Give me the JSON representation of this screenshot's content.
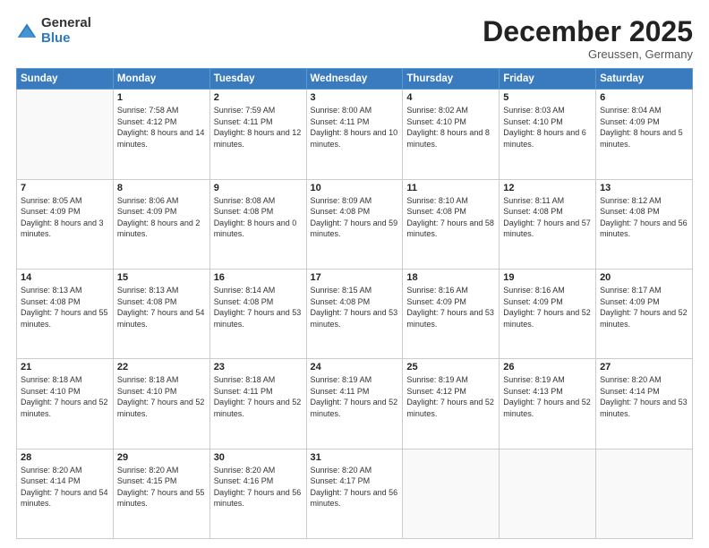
{
  "logo": {
    "general": "General",
    "blue": "Blue"
  },
  "header": {
    "month": "December 2025",
    "location": "Greussen, Germany"
  },
  "weekdays": [
    "Sunday",
    "Monday",
    "Tuesday",
    "Wednesday",
    "Thursday",
    "Friday",
    "Saturday"
  ],
  "weeks": [
    [
      {
        "day": "",
        "sunrise": "",
        "sunset": "",
        "daylight": ""
      },
      {
        "day": "1",
        "sunrise": "Sunrise: 7:58 AM",
        "sunset": "Sunset: 4:12 PM",
        "daylight": "Daylight: 8 hours and 14 minutes."
      },
      {
        "day": "2",
        "sunrise": "Sunrise: 7:59 AM",
        "sunset": "Sunset: 4:11 PM",
        "daylight": "Daylight: 8 hours and 12 minutes."
      },
      {
        "day": "3",
        "sunrise": "Sunrise: 8:00 AM",
        "sunset": "Sunset: 4:11 PM",
        "daylight": "Daylight: 8 hours and 10 minutes."
      },
      {
        "day": "4",
        "sunrise": "Sunrise: 8:02 AM",
        "sunset": "Sunset: 4:10 PM",
        "daylight": "Daylight: 8 hours and 8 minutes."
      },
      {
        "day": "5",
        "sunrise": "Sunrise: 8:03 AM",
        "sunset": "Sunset: 4:10 PM",
        "daylight": "Daylight: 8 hours and 6 minutes."
      },
      {
        "day": "6",
        "sunrise": "Sunrise: 8:04 AM",
        "sunset": "Sunset: 4:09 PM",
        "daylight": "Daylight: 8 hours and 5 minutes."
      }
    ],
    [
      {
        "day": "7",
        "sunrise": "Sunrise: 8:05 AM",
        "sunset": "Sunset: 4:09 PM",
        "daylight": "Daylight: 8 hours and 3 minutes."
      },
      {
        "day": "8",
        "sunrise": "Sunrise: 8:06 AM",
        "sunset": "Sunset: 4:09 PM",
        "daylight": "Daylight: 8 hours and 2 minutes."
      },
      {
        "day": "9",
        "sunrise": "Sunrise: 8:08 AM",
        "sunset": "Sunset: 4:08 PM",
        "daylight": "Daylight: 8 hours and 0 minutes."
      },
      {
        "day": "10",
        "sunrise": "Sunrise: 8:09 AM",
        "sunset": "Sunset: 4:08 PM",
        "daylight": "Daylight: 7 hours and 59 minutes."
      },
      {
        "day": "11",
        "sunrise": "Sunrise: 8:10 AM",
        "sunset": "Sunset: 4:08 PM",
        "daylight": "Daylight: 7 hours and 58 minutes."
      },
      {
        "day": "12",
        "sunrise": "Sunrise: 8:11 AM",
        "sunset": "Sunset: 4:08 PM",
        "daylight": "Daylight: 7 hours and 57 minutes."
      },
      {
        "day": "13",
        "sunrise": "Sunrise: 8:12 AM",
        "sunset": "Sunset: 4:08 PM",
        "daylight": "Daylight: 7 hours and 56 minutes."
      }
    ],
    [
      {
        "day": "14",
        "sunrise": "Sunrise: 8:13 AM",
        "sunset": "Sunset: 4:08 PM",
        "daylight": "Daylight: 7 hours and 55 minutes."
      },
      {
        "day": "15",
        "sunrise": "Sunrise: 8:13 AM",
        "sunset": "Sunset: 4:08 PM",
        "daylight": "Daylight: 7 hours and 54 minutes."
      },
      {
        "day": "16",
        "sunrise": "Sunrise: 8:14 AM",
        "sunset": "Sunset: 4:08 PM",
        "daylight": "Daylight: 7 hours and 53 minutes."
      },
      {
        "day": "17",
        "sunrise": "Sunrise: 8:15 AM",
        "sunset": "Sunset: 4:08 PM",
        "daylight": "Daylight: 7 hours and 53 minutes."
      },
      {
        "day": "18",
        "sunrise": "Sunrise: 8:16 AM",
        "sunset": "Sunset: 4:09 PM",
        "daylight": "Daylight: 7 hours and 53 minutes."
      },
      {
        "day": "19",
        "sunrise": "Sunrise: 8:16 AM",
        "sunset": "Sunset: 4:09 PM",
        "daylight": "Daylight: 7 hours and 52 minutes."
      },
      {
        "day": "20",
        "sunrise": "Sunrise: 8:17 AM",
        "sunset": "Sunset: 4:09 PM",
        "daylight": "Daylight: 7 hours and 52 minutes."
      }
    ],
    [
      {
        "day": "21",
        "sunrise": "Sunrise: 8:18 AM",
        "sunset": "Sunset: 4:10 PM",
        "daylight": "Daylight: 7 hours and 52 minutes."
      },
      {
        "day": "22",
        "sunrise": "Sunrise: 8:18 AM",
        "sunset": "Sunset: 4:10 PM",
        "daylight": "Daylight: 7 hours and 52 minutes."
      },
      {
        "day": "23",
        "sunrise": "Sunrise: 8:18 AM",
        "sunset": "Sunset: 4:11 PM",
        "daylight": "Daylight: 7 hours and 52 minutes."
      },
      {
        "day": "24",
        "sunrise": "Sunrise: 8:19 AM",
        "sunset": "Sunset: 4:11 PM",
        "daylight": "Daylight: 7 hours and 52 minutes."
      },
      {
        "day": "25",
        "sunrise": "Sunrise: 8:19 AM",
        "sunset": "Sunset: 4:12 PM",
        "daylight": "Daylight: 7 hours and 52 minutes."
      },
      {
        "day": "26",
        "sunrise": "Sunrise: 8:19 AM",
        "sunset": "Sunset: 4:13 PM",
        "daylight": "Daylight: 7 hours and 52 minutes."
      },
      {
        "day": "27",
        "sunrise": "Sunrise: 8:20 AM",
        "sunset": "Sunset: 4:14 PM",
        "daylight": "Daylight: 7 hours and 53 minutes."
      }
    ],
    [
      {
        "day": "28",
        "sunrise": "Sunrise: 8:20 AM",
        "sunset": "Sunset: 4:14 PM",
        "daylight": "Daylight: 7 hours and 54 minutes."
      },
      {
        "day": "29",
        "sunrise": "Sunrise: 8:20 AM",
        "sunset": "Sunset: 4:15 PM",
        "daylight": "Daylight: 7 hours and 55 minutes."
      },
      {
        "day": "30",
        "sunrise": "Sunrise: 8:20 AM",
        "sunset": "Sunset: 4:16 PM",
        "daylight": "Daylight: 7 hours and 56 minutes."
      },
      {
        "day": "31",
        "sunrise": "Sunrise: 8:20 AM",
        "sunset": "Sunset: 4:17 PM",
        "daylight": "Daylight: 7 hours and 56 minutes."
      },
      {
        "day": "",
        "sunrise": "",
        "sunset": "",
        "daylight": ""
      },
      {
        "day": "",
        "sunrise": "",
        "sunset": "",
        "daylight": ""
      },
      {
        "day": "",
        "sunrise": "",
        "sunset": "",
        "daylight": ""
      }
    ]
  ]
}
